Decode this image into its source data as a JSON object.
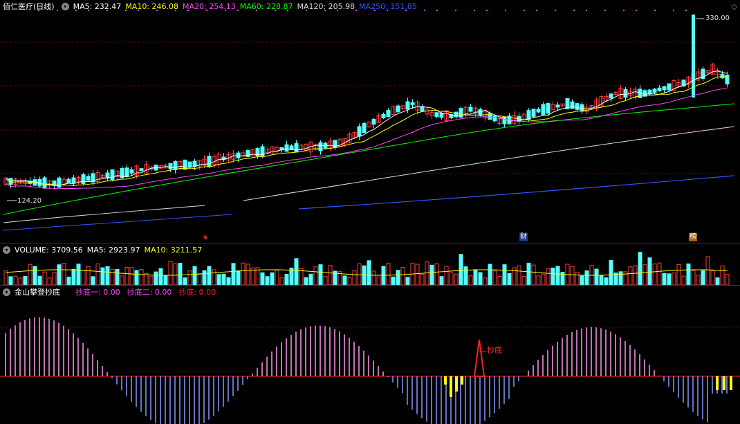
{
  "main": {
    "title": "佰仁医疗(日线)",
    "ma_items": [
      {
        "label": "MA5: 232.47",
        "color": "#ffffff"
      },
      {
        "label": "MA10: 246.08",
        "color": "#ffff00"
      },
      {
        "label": "MA20: 254.13",
        "color": "#ff44ff"
      },
      {
        "label": "MA60: 228.87",
        "color": "#00ff00"
      },
      {
        "label": "MA120: 205.98",
        "color": "#dddddd"
      },
      {
        "label": "MA250: 151.85",
        "color": "#3355ff"
      }
    ],
    "high_label": "330.00",
    "low_label": "124.20",
    "markers": {
      "s": "s",
      "cai": "财",
      "bang": "榜"
    },
    "up_color": "#ff3c3c",
    "down_color": "#54ffff"
  },
  "volume": {
    "title": "VOLUME: 3709.56",
    "ma5": "MA5: 2923.97",
    "ma10": "MA10: 3211.57"
  },
  "indicator": {
    "title": "金山攀登抄底",
    "items": [
      {
        "label": "抄底一: 0.00",
        "color": "#ff44ff"
      },
      {
        "label": "抄底二: 0.00",
        "color": "#ff44ff"
      },
      {
        "label": "抄底: 0.00",
        "color": "#ff2020"
      }
    ],
    "signal_label": "抄底"
  }
}
